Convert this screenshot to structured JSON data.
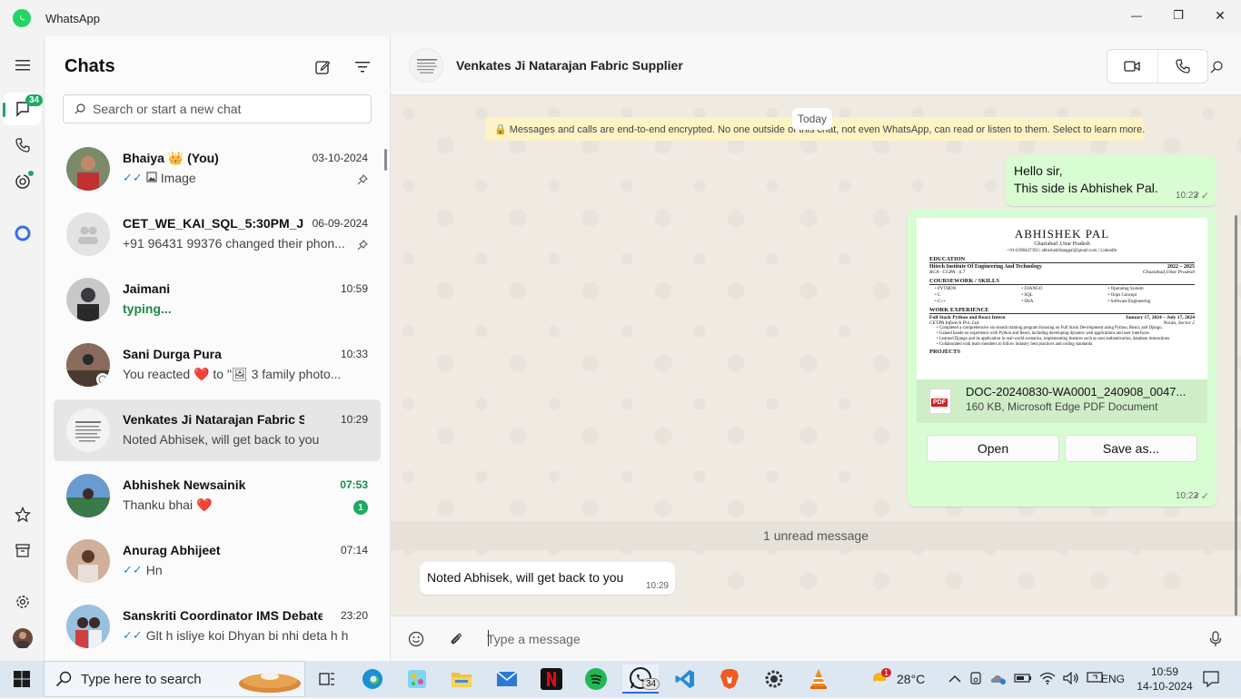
{
  "window": {
    "title": "WhatsApp",
    "minimize_glyph": "—",
    "restore_glyph": "❐",
    "close_glyph": "✕"
  },
  "rail": {
    "chats_badge": "34",
    "icons": [
      "menu-icon",
      "chats-icon",
      "calls-icon",
      "status-icon",
      "meta-ai-icon",
      "starred-icon",
      "archive-icon",
      "settings-icon",
      "profile-avatar"
    ]
  },
  "chatlist": {
    "title": "Chats",
    "search_placeholder": "Search or start a new chat",
    "chats": [
      {
        "name": "Bhaiya 👑 (You)",
        "time": "03-10-2024",
        "preview": "Image",
        "ticks": "✓✓",
        "pinned": true,
        "avatar_color": "#b33a3a"
      },
      {
        "name": "CET_WE_KAI_SQL_5:30PM_J...",
        "time": "06-09-2024",
        "preview": "+91 96431 99376 changed their phon...",
        "ticks": "",
        "pinned": true,
        "avatar_color": "#e3e3e3"
      },
      {
        "name": "Jaimani",
        "time": "10:59",
        "preview": "typing...",
        "ticks": "",
        "pinned": false,
        "avatar_color": "#5a5a60"
      },
      {
        "name": "Sani Durga Pura",
        "time": "10:33",
        "preview": "You reacted ❤️ to \"🖼 3 family photo...",
        "ticks": "",
        "pinned": false,
        "avatar_color": "#6b4a3a"
      },
      {
        "name": "Venkates Ji Natarajan Fabric Sup...",
        "time": "10:29",
        "preview": "Noted Abhisek, will get back to you",
        "ticks": "",
        "pinned": false,
        "avatar_color": "#f0f0f0"
      },
      {
        "name": "Abhishek Newsainik",
        "time": "07:53",
        "preview": "Thanku bhai ❤️",
        "ticks": "",
        "pinned": false,
        "unread": "1",
        "avatar_color": "#4a8a6a"
      },
      {
        "name": "Anurag Abhijeet",
        "time": "07:14",
        "preview": "Hn",
        "ticks": "✓✓",
        "pinned": false,
        "avatar_color": "#8a6a50"
      },
      {
        "name": "Sanskriti Coordinator IMS Debate",
        "time": "23:20",
        "preview": "Glt h isliye koi Dhyan bi nhi deta h h",
        "ticks": "✓✓",
        "pinned": false,
        "avatar_color": "#3a6a9a"
      }
    ]
  },
  "conversation": {
    "name": "Venkates Ji Natarajan Fabric Supplier",
    "date_chip": "Today",
    "encryption_notice": "🔒 Messages and calls are end-to-end encrypted. No one outside of this chat, not even WhatsApp, can read or listen to them. Select to learn more.",
    "message1": {
      "line1": "Hello sir,",
      "line2": "This side is Abhishek Pal.",
      "time": "10:23",
      "ticks": "✓✓"
    },
    "document": {
      "resume_name": "ABHISHEK PAL",
      "resume_location": "Ghaziabad ,Uttar Pradesh",
      "resume_contact": "+91-6398447392 | abhishekfdangpal@gmail.com | LinkedIn",
      "sections": {
        "education": "EDUCATION",
        "education_school": "Hitech Institute Of Engineering And Technology",
        "education_years": "2022 – 2025",
        "education_degree": "BCA · CGPA : 6.7",
        "education_place": "Ghaziabad,Uttar Pradesh",
        "coursework": "COURSEWORK / SKILLS",
        "skills": [
          "• PYTHON",
          "• DJANGO",
          "• Operating System",
          "• C",
          "• SQL",
          "• Oops Concept",
          "• C++",
          "• DSA",
          "• Software Engineering"
        ],
        "work": "WORK EXPERIENCE",
        "work_title": "Full Stack Python and React Intern",
        "work_dates": "January 17, 2024 – July 17, 2024",
        "work_company": "CETPA Infotech Pvt. Ltd.",
        "work_place": "Noida, Sector 2",
        "bullets": [
          "• Completed a comprehensive six-month training program focusing on Full Stack Development using Python, React, and Django.",
          "• Gained hands-on experience with Python and React, including developing dynamic web applications and user interfaces.",
          "• Learned Django and its application in real-world scenarios, implementing features such as user authentication, database interactions.",
          "• Collaborated with team members to follow industry best practices and coding standards."
        ],
        "projects": "PROJECTS"
      },
      "file_name": "DOC-20240830-WA0001_240908_0047...",
      "file_meta": "160 KB, Microsoft Edge PDF Document",
      "file_badge": "PDF",
      "open_label": "Open",
      "save_label": "Save as...",
      "time": "10:23",
      "ticks": "✓✓"
    },
    "unread_divider": "1 unread message",
    "incoming": {
      "text": "Noted Abhisek, will get back to you",
      "time": "10:29"
    },
    "composer_placeholder": "Type a message"
  },
  "taskbar": {
    "search_placeholder": "Type here to search",
    "weather": "28°C",
    "weather_badge": "1",
    "whatsapp_badge": "34",
    "language": "ENG",
    "time": "10:59",
    "date": "14-10-2024"
  }
}
